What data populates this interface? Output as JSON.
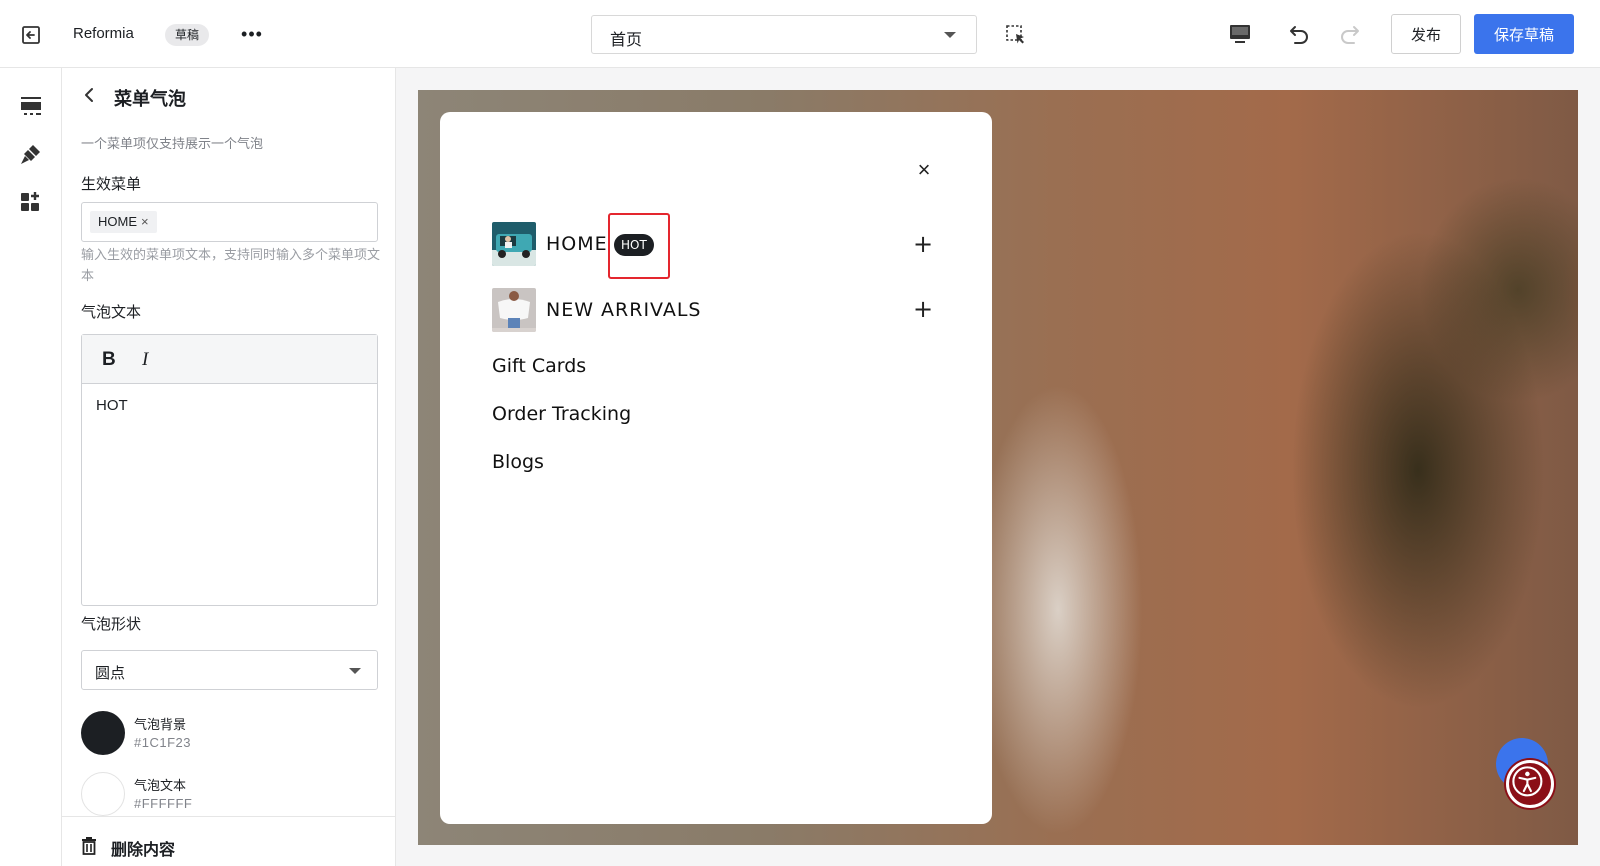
{
  "topbar": {
    "store_name": "Reformia",
    "status_badge": "草稿",
    "more_label": "•••",
    "page_select_value": "首页",
    "publish_label": "发布",
    "save_draft_label": "保存草稿"
  },
  "panel": {
    "title": "菜单气泡",
    "hint": "一个菜单项仅支持展示一个气泡",
    "effective_menu_label": "生效菜单",
    "effective_menu_tag": "HOME",
    "effective_menu_tag_remove": "×",
    "effective_menu_hint": "输入生效的菜单项文本，支持同时输入多个菜单项文本",
    "bubble_text_label": "气泡文本",
    "bold_label": "B",
    "italic_label": "I",
    "bubble_text_value": "HOT",
    "bubble_shape_label": "气泡形状",
    "bubble_shape_value": "圆点",
    "bubble_bg_label": "气泡背景",
    "bubble_bg_hex": "#1C1F23",
    "bubble_text_color_label": "气泡文本",
    "bubble_text_color_hex": "#FFFFFF",
    "delete_label": "删除内容"
  },
  "preview": {
    "close_label": "×",
    "menu_items": [
      {
        "label": "HOME",
        "badge": "HOT",
        "expand": "+"
      },
      {
        "label": "NEW ARRIVALS",
        "expand": "+"
      }
    ],
    "links": [
      "Gift Cards",
      "Order Tracking",
      "Blogs"
    ]
  },
  "colors": {
    "accent": "#3b74ec",
    "bubble_bg": "#1C1F23",
    "bubble_text": "#FFFFFF",
    "highlight": "#e4262e"
  },
  "icons": {
    "exit": "exit-icon",
    "select_tool": "select-element-icon",
    "device": "desktop-icon",
    "undo": "undo-icon",
    "redo": "redo-icon",
    "sections": "sections-icon",
    "theme": "brush-icon",
    "apps": "apps-icon",
    "back": "chevron-left-icon",
    "delete": "trash-icon",
    "accessibility": "accessibility-icon",
    "chat": "chat-icon"
  }
}
